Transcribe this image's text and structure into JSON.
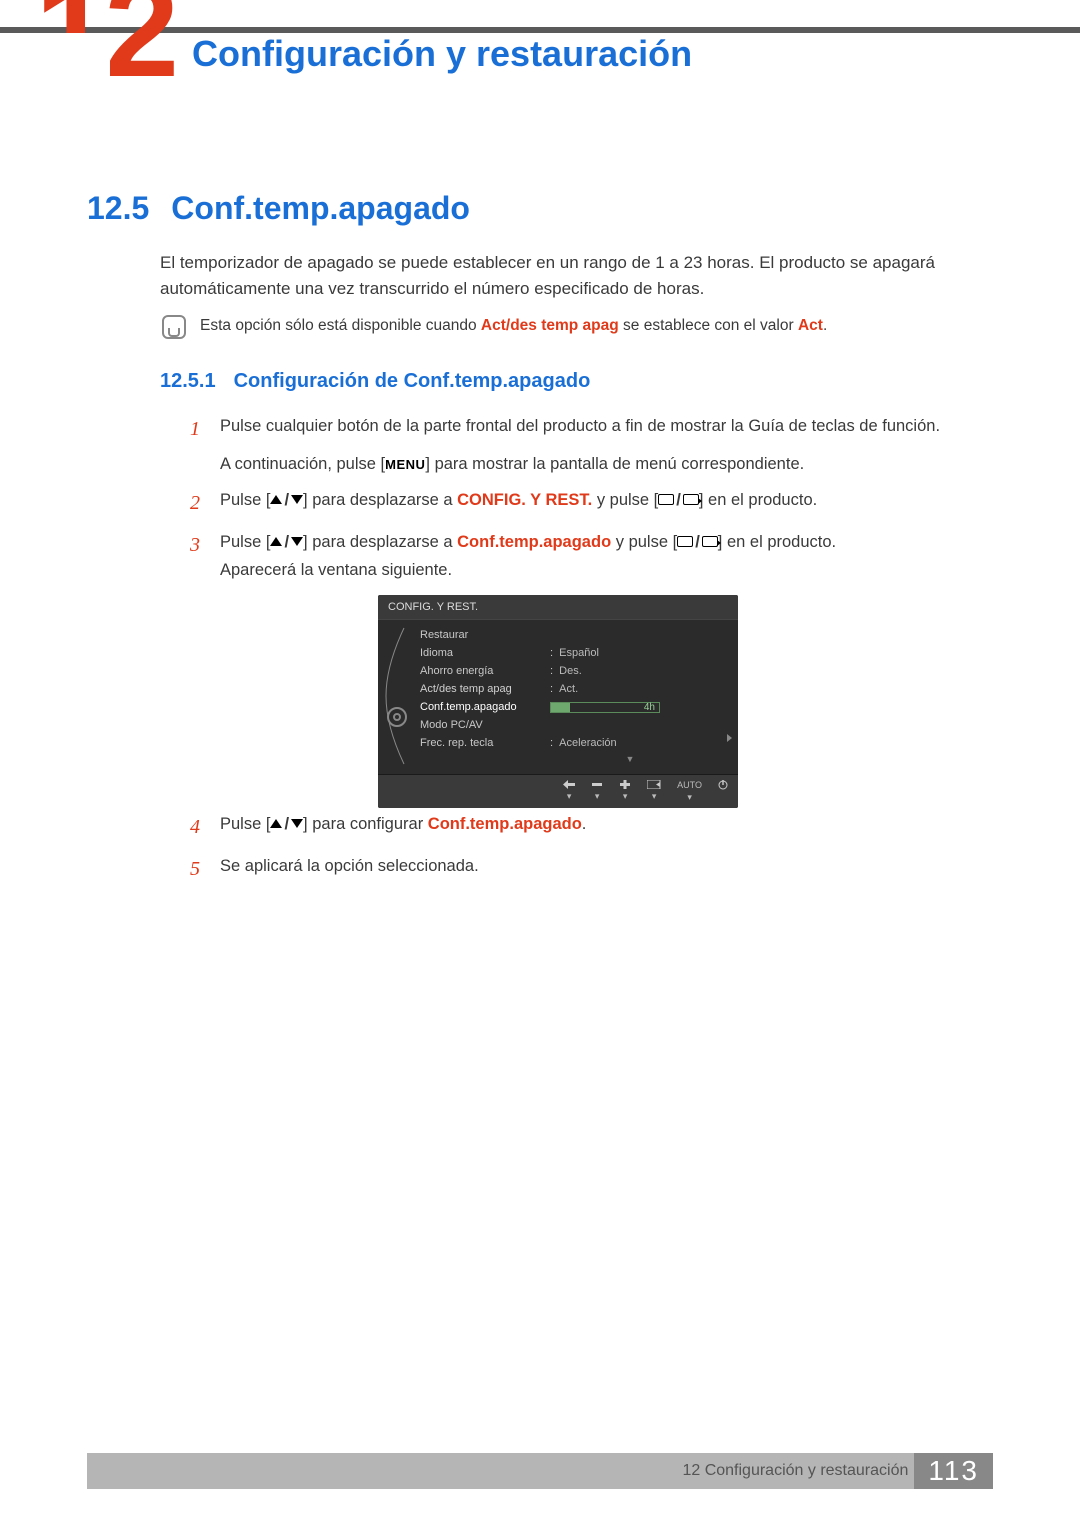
{
  "chapter_bg_number": "12",
  "chapter_title": "Configuración y restauración",
  "section": {
    "num": "12.5",
    "title": "Conf.temp.apagado"
  },
  "intro": "El temporizador de apagado se puede establecer en un rango de 1 a 23 horas. El producto se apagará automáticamente una vez transcurrido el número especificado de horas.",
  "note": {
    "pre": "Esta opción sólo está disponible cuando ",
    "hl1": "Act/des temp apag",
    "mid": " se establece con el valor ",
    "hl2": "Act",
    "post": "."
  },
  "subsection": {
    "num": "12.5.1",
    "title": "Configuración de Conf.temp.apagado"
  },
  "steps": {
    "s1_a": "Pulse cualquier botón de la parte frontal del producto a fin de mostrar la Guía de teclas de función.",
    "s1_b_pre": "A continuación, pulse [",
    "s1_b_menu": "MENU",
    "s1_b_post": "] para mostrar la pantalla de menú correspondiente.",
    "s2_pre": "Pulse [",
    "s2_mid": "] para desplazarse a ",
    "s2_target": "CONFIG. Y REST.",
    "s2_post1": " y pulse [",
    "s2_post2": "] en el producto.",
    "s3_pre": "Pulse [",
    "s3_mid": "] para desplazarse a ",
    "s3_target": "Conf.temp.apagado",
    "s3_post1": " y pulse [",
    "s3_post2": "] en el producto.",
    "s3_after": "Aparecerá la ventana siguiente.",
    "s4_pre": "Pulse [",
    "s4_mid": "] para configurar ",
    "s4_target": "Conf.temp.apagado",
    "s4_post": ".",
    "s5": "Se aplicará la opción seleccionada."
  },
  "osd": {
    "title": "CONFIG. Y REST.",
    "items": [
      {
        "label": "Restaurar",
        "value": ""
      },
      {
        "label": "Idioma",
        "value": "Español"
      },
      {
        "label": "Ahorro energía",
        "value": "Des."
      },
      {
        "label": "Act/des temp apag",
        "value": "Act."
      },
      {
        "label": "Conf.temp.apagado",
        "value": "4h"
      },
      {
        "label": "Modo PC/AV",
        "value": ""
      },
      {
        "label": "Frec. rep. tecla",
        "value": "Aceleración"
      }
    ],
    "footer_auto": "AUTO"
  },
  "footer": {
    "text": "12 Configuración y restauración",
    "page": "113"
  }
}
